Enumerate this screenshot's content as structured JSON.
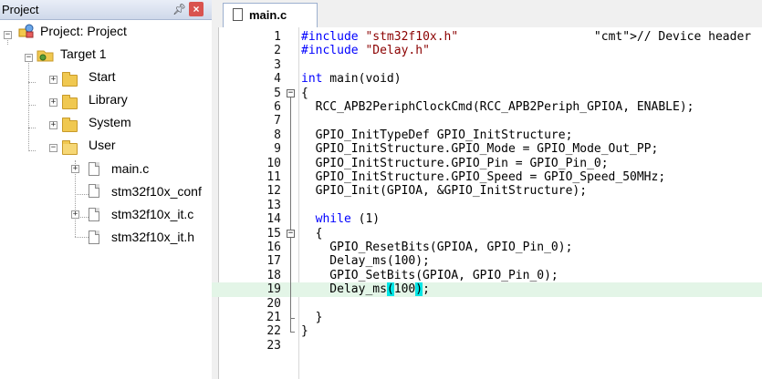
{
  "project_panel": {
    "title": "Project",
    "pin_icon": "pin-icon",
    "close_icon": "close-icon",
    "tree": {
      "root": "Project: Project",
      "target": "Target 1",
      "groups": [
        "Start",
        "Library",
        "System",
        "User"
      ],
      "user_files": [
        "main.c",
        "stm32f10x_conf",
        "stm32f10x_it.c",
        "stm32f10x_it.h"
      ]
    }
  },
  "editor": {
    "tab_label": "main.c",
    "lines": [
      {
        "n": "1",
        "code": "#include \"stm32f10x.h\"                   // Device header"
      },
      {
        "n": "2",
        "code": "#include \"Delay.h\""
      },
      {
        "n": "3",
        "code": ""
      },
      {
        "n": "4",
        "code": "int main(void)"
      },
      {
        "n": "5",
        "code": "{"
      },
      {
        "n": "6",
        "code": "  RCC_APB2PeriphClockCmd(RCC_APB2Periph_GPIOA, ENABLE);"
      },
      {
        "n": "7",
        "code": ""
      },
      {
        "n": "8",
        "code": "  GPIO_InitTypeDef GPIO_InitStructure;"
      },
      {
        "n": "9",
        "code": "  GPIO_InitStructure.GPIO_Mode = GPIO_Mode_Out_PP;"
      },
      {
        "n": "10",
        "code": "  GPIO_InitStructure.GPIO_Pin = GPIO_Pin_0;"
      },
      {
        "n": "11",
        "code": "  GPIO_InitStructure.GPIO_Speed = GPIO_Speed_50MHz;"
      },
      {
        "n": "12",
        "code": "  GPIO_Init(GPIOA, &GPIO_InitStructure);"
      },
      {
        "n": "13",
        "code": ""
      },
      {
        "n": "14",
        "code": "  while (1)"
      },
      {
        "n": "15",
        "code": "  {"
      },
      {
        "n": "16",
        "code": "    GPIO_ResetBits(GPIOA, GPIO_Pin_0);"
      },
      {
        "n": "17",
        "code": "    Delay_ms(100);"
      },
      {
        "n": "18",
        "code": "    GPIO_SetBits(GPIOA, GPIO_Pin_0);"
      },
      {
        "n": "19",
        "code": "    Delay_ms(100);"
      },
      {
        "n": "20",
        "code": ""
      },
      {
        "n": "21",
        "code": "  }"
      },
      {
        "n": "22",
        "code": "}"
      },
      {
        "n": "23",
        "code": ""
      }
    ],
    "highlight_line": "19",
    "colors": {
      "keyword": "#0000ff",
      "string": "#8b0000",
      "comment": "#008000",
      "current_line": "#e3f5e7",
      "brace_match": "#00e5e5"
    }
  }
}
